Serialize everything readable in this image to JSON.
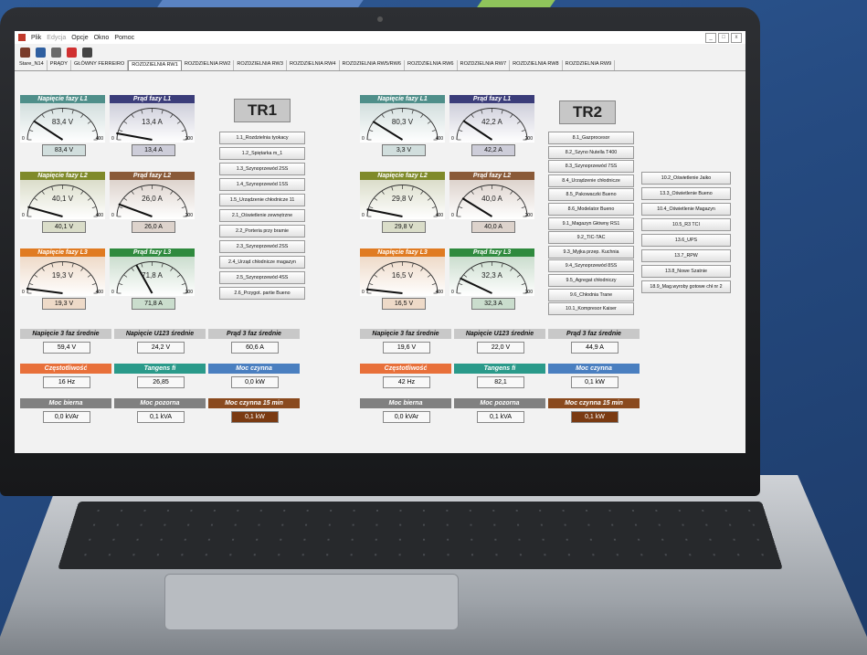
{
  "window": {
    "menu": [
      "Plik",
      "Edycja",
      "Opcje",
      "Okno",
      "Pomoc"
    ],
    "toolbar_icons": [
      "chart-icon",
      "trend-icon",
      "bar-icon",
      "pin-icon",
      "user-icon"
    ],
    "tabs": [
      "Stare_N14",
      "PRĄDY",
      "GŁÓWNY FERREIRO",
      "ROZDZIELNIA RW1",
      "ROZDZIELNIA RW2",
      "ROZDZIELNIA RW3",
      "ROZDZIELNIA RW4",
      "ROZDZIELNIA RW5/RW6",
      "ROZDZIELNIA RW6",
      "ROZDZIELNIA RW7",
      "ROZDZIELNIA RW8",
      "ROZDZIELNIA RW9"
    ],
    "active_tab": "ROZDZIELNIA RW1"
  },
  "tr1": {
    "title": "TR1",
    "gauges": [
      {
        "label": "Napięcie fazy L1",
        "reading": "83,4 V",
        "min": "0",
        "max": "400",
        "value": "83,4 V",
        "color": "#4f8f8a"
      },
      {
        "label": "Prąd fazy L1",
        "reading": "13,4 A",
        "min": "0",
        "max": "200",
        "value": "13,4 A",
        "color": "#3b3d7a"
      },
      {
        "label": "Napięcie fazy L2",
        "reading": "40,1 V",
        "min": "0",
        "max": "400",
        "value": "40,1 V",
        "color": "#7f8a2a"
      },
      {
        "label": "Prąd fazy L2",
        "reading": "26,0 A",
        "min": "0",
        "max": "200",
        "value": "26,0 A",
        "color": "#8a5a38"
      },
      {
        "label": "Napięcie fazy L3",
        "reading": "19,3 V",
        "min": "0",
        "max": "400",
        "value": "19,3 V",
        "color": "#e07b22"
      },
      {
        "label": "Prąd fazy L3",
        "reading": "71,8 A",
        "min": "0",
        "max": "200",
        "value": "71,8 A",
        "color": "#2f8a3e"
      }
    ],
    "buttons": [
      "1.1_Rozdzielnia tyokacy",
      "1.2_Spiętarka m_1",
      "1.3_Szynoprzewód 2SS",
      "1.4_Szynoprzewód 1SS",
      "1.5_Urządzenie chłodnicze 11",
      "2.1_Oświetlenie zewnętrzne",
      "2.2_Porteria przy bramie",
      "2.3_Szynoprzewód 2SS",
      "2.4_Urząd chłodnicze magazyn",
      "2.5_Szynoprzewód 4SS",
      "2.6_Przygot. partie Bueno"
    ],
    "summary": [
      {
        "label": "Napięcie 3 faz średnie",
        "value": "59,4 V",
        "bg": "#c8c8c8",
        "fg": "#111"
      },
      {
        "label": "Napięcie U123 średnie",
        "value": "24,2 V",
        "bg": "#c8c8c8",
        "fg": "#111"
      },
      {
        "label": "Prąd 3 faz średnie",
        "value": "60,6 A",
        "bg": "#c8c8c8",
        "fg": "#111"
      },
      {
        "label": "Częstotliwość",
        "value": "16 Hz",
        "bg": "#e8703a",
        "fg": "#fff"
      },
      {
        "label": "Tangens fi",
        "value": "26,85",
        "bg": "#2a9a8a",
        "fg": "#fff"
      },
      {
        "label": "Moc czynna",
        "value": "0,0 kW",
        "bg": "#4a7fc0",
        "fg": "#fff"
      },
      {
        "label": "Moc bierna",
        "value": "0,0 kVAr",
        "bg": "#808080",
        "fg": "#fff"
      },
      {
        "label": "Moc pozorna",
        "value": "0,1 kVA",
        "bg": "#808080",
        "fg": "#fff"
      },
      {
        "label": "Moc czynna 15 min",
        "value": "0,1 kW",
        "bg": "#8a4a1e",
        "fg": "#fff"
      }
    ]
  },
  "tr2": {
    "title": "TR2",
    "gauges": [
      {
        "label": "Napięcie fazy L1",
        "reading": "80,3 V",
        "min": "0",
        "max": "400",
        "value": "3,3 V",
        "color": "#4f8f8a"
      },
      {
        "label": "Prąd fazy L1",
        "reading": "42,2 A",
        "min": "0",
        "max": "200",
        "value": "42,2 A",
        "color": "#3b3d7a"
      },
      {
        "label": "Napięcie fazy L2",
        "reading": "29,8 V",
        "min": "0",
        "max": "400",
        "value": "29,8 V",
        "color": "#7f8a2a"
      },
      {
        "label": "Prąd fazy L2",
        "reading": "40,0 A",
        "min": "0",
        "max": "200",
        "value": "40,0 A",
        "color": "#8a5a38"
      },
      {
        "label": "Napięcie fazy L3",
        "reading": "16,5 V",
        "min": "0",
        "max": "400",
        "value": "16,5 V",
        "color": "#e07b22"
      },
      {
        "label": "Prąd fazy L3",
        "reading": "32,3 A",
        "min": "0",
        "max": "200",
        "value": "32,3 A",
        "color": "#2f8a3e"
      }
    ],
    "buttons_left": [
      "8.1_Gazprocesor",
      "8.2_Szyno Nutella T400",
      "8.3_Szynoprzewód 7SS",
      "8.4_Urządzenie chłodnicze",
      "8.5_Pakowaczki Bueno",
      "8.6_Modelator Bueno",
      "9.1_Magazyn Główny RS1",
      "9.2_TIC-TAC",
      "9.3_Myjka przep. Kuchnia",
      "9.4_Szynoprzewód 8SS",
      "9.5_Agregat chłodniczy",
      "9.6_Chłodnia Trane",
      "10.1_Kompresor Kaiser"
    ],
    "buttons_right": [
      "10.2_Oświetlenie Jaiko",
      "13.3_Oświetlenie Bueno",
      "10.4_Oświetlenie Magazyn",
      "10.5_R3 TCI",
      "13.6_UPS",
      "13.7_RPW",
      "13.8_Nowe Szatnie",
      "18.9_Mag.wyroby gotowe chł nr 2"
    ],
    "summary": [
      {
        "label": "Napięcie 3 faz średnie",
        "value": "19,6 V",
        "bg": "#c8c8c8",
        "fg": "#111"
      },
      {
        "label": "Napięcie U123 średnie",
        "value": "22,0 V",
        "bg": "#c8c8c8",
        "fg": "#111"
      },
      {
        "label": "Prąd 3 faz średnie",
        "value": "44,9 A",
        "bg": "#c8c8c8",
        "fg": "#111"
      },
      {
        "label": "Częstotliwość",
        "value": "42 Hz",
        "bg": "#e8703a",
        "fg": "#fff"
      },
      {
        "label": "Tangens fi",
        "value": "82,1",
        "bg": "#2a9a8a",
        "fg": "#fff"
      },
      {
        "label": "Moc czynna",
        "value": "0,1 kW",
        "bg": "#4a7fc0",
        "fg": "#fff"
      },
      {
        "label": "Moc bierna",
        "value": "0,0 kVAr",
        "bg": "#808080",
        "fg": "#fff"
      },
      {
        "label": "Moc pozorna",
        "value": "0,1 kVA",
        "bg": "#808080",
        "fg": "#fff"
      },
      {
        "label": "Moc czynna 15 min",
        "value": "0,1 kW",
        "bg": "#8a4a1e",
        "fg": "#fff"
      }
    ]
  }
}
